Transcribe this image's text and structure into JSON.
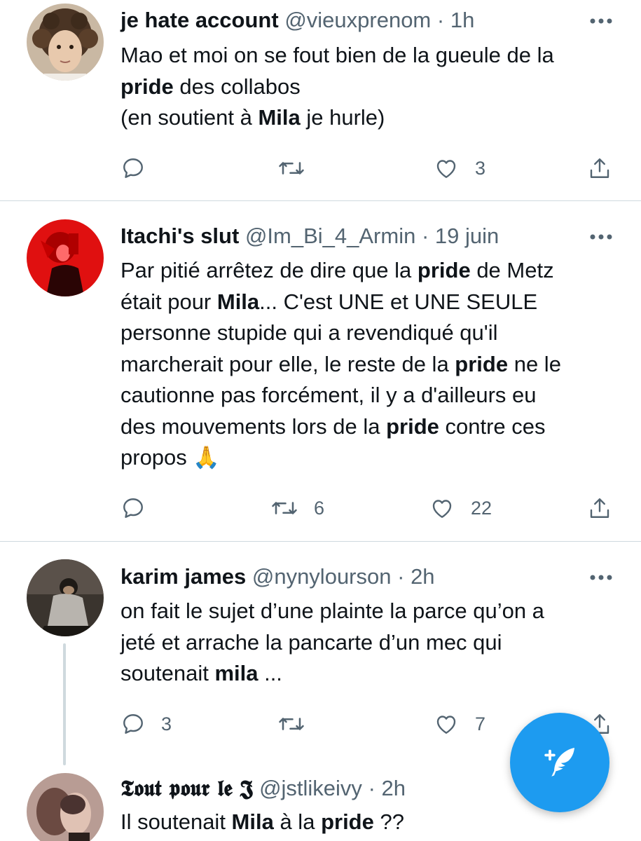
{
  "tweets": [
    {
      "name": "je hate account",
      "handle": "@vieuxprenom",
      "dot": "·",
      "time": "1h",
      "body": {
        "l1": "Mao et moi on se fout bien de la gueule de la",
        "l2_b1": "pride",
        "l2_t1": " des collabos",
        "l3_t1": "(en soutient à ",
        "l3_b1": "Mila",
        "l3_t2": " je hurle)"
      },
      "replies": "",
      "retweets": "",
      "likes": "3"
    },
    {
      "name": "Itachi's slut",
      "handle": "@Im_Bi_4_Armin",
      "dot": "·",
      "time": "19 juin",
      "body": {
        "l1_t1": "Par pitié arrêtez de dire que la ",
        "l1_b1": "pride",
        "l1_t2": " de Metz",
        "l2_t1": "était pour ",
        "l2_b1": "Mila",
        "l2_t2": "... C'est UNE et UNE SEULE",
        "l3": "personne stupide qui a revendiqué qu'il",
        "l4_t1": "marcherait pour elle, le reste de la ",
        "l4_b1": "pride",
        "l4_t2": " ne le",
        "l5": "cautionne pas forcément, il y a d'ailleurs eu",
        "l6_t1": "des mouvements lors de la ",
        "l6_b1": "pride",
        "l6_t2": " contre ces",
        "l7_t1": "propos ",
        "l7_emoji": "🙏"
      },
      "replies": "",
      "retweets": "6",
      "likes": "22"
    },
    {
      "name": "karim james",
      "handle": "@nynylourson",
      "dot": "·",
      "time": "2h",
      "body": {
        "l1": "on fait le sujet d’une plainte la parce qu’on a",
        "l2": "jeté et arrache la pancarte d’un mec qui",
        "l3_t1": "soutenait ",
        "l3_b1": "mila",
        "l3_t2": " ..."
      },
      "replies": "3",
      "retweets": "",
      "likes": "7"
    },
    {
      "name": "𝕿𝖔𝖚𝖙 𝖕𝖔𝖚𝖗 𝖑𝖊 𝕵",
      "handle": "@jstlikeivy",
      "dot": "·",
      "time": "2h",
      "body": {
        "l1_t1": "Il soutenait ",
        "l1_b1": "Mila",
        "l1_t2": " à la ",
        "l1_b2": "pride",
        "l1_t3": " ??"
      }
    }
  ],
  "icons": {
    "reply": "reply-icon",
    "retweet": "retweet-icon",
    "like": "heart-icon",
    "share": "share-icon",
    "more": "more-icon",
    "compose": "compose-tweet-icon"
  },
  "colors": {
    "accent": "#1d9bf0",
    "secondary_text": "#536471",
    "divider": "#cfd9de"
  }
}
